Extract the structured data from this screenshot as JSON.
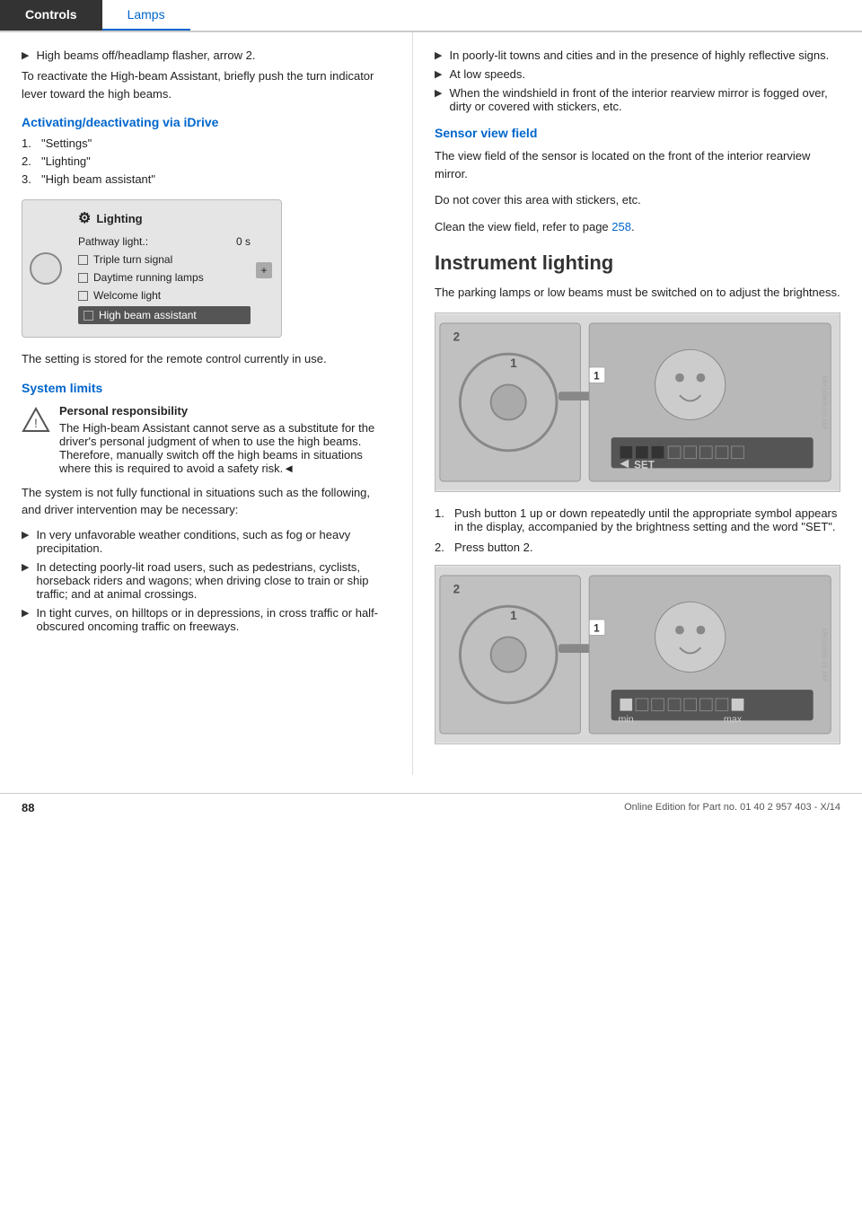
{
  "header": {
    "tab_controls": "Controls",
    "tab_lamps": "Lamps"
  },
  "left_col": {
    "bullet1": "High beams off/headlamp flasher, arrow 2.",
    "reactivate_text": "To reactivate the High-beam Assistant, briefly push the turn indicator lever toward the high beams.",
    "activating_heading": "Activating/deactivating via iDrive",
    "step1": "\"Settings\"",
    "step2": "\"Lighting\"",
    "step3": "\"High beam assistant\"",
    "idrive": {
      "title": "Lighting",
      "pathway_label": "Pathway light.:",
      "pathway_value": "0 s",
      "triple_label": "Triple turn signal",
      "daytime_label": "Daytime running lamps",
      "welcome_label": "Welcome light",
      "high_beam_label": "High beam assistant"
    },
    "setting_stored": "The setting is stored for the remote control currently in use.",
    "system_limits_heading": "System limits",
    "warning_title": "Personal responsibility",
    "warning_text": "The High-beam Assistant cannot serve as a substitute for the driver's personal judgment of when to use the high beams. Therefore, manually switch off the high beams in situations where this is required to avoid a safety risk.◄",
    "system_not_functional": "The system is not fully functional in situations such as the following, and driver intervention may be necessary:",
    "limit1": "In very unfavorable weather conditions, such as fog or heavy precipitation.",
    "limit2": "In detecting poorly-lit road users, such as pedestrians, cyclists, horseback riders and wagons; when driving close to train or ship traffic; and at animal crossings.",
    "limit3": "In tight curves, on hilltops or in depressions, in cross traffic or half-obscured oncoming traffic on freeways."
  },
  "right_col": {
    "limit4": "In poorly-lit towns and cities and in the presence of highly reflective signs.",
    "limit5": "At low speeds.",
    "limit6": "When the windshield in front of the interior rearview mirror is fogged over, dirty or covered with stickers, etc.",
    "sensor_heading": "Sensor view field",
    "sensor_text1": "The view field of the sensor is located on the front of the interior rearview mirror.",
    "sensor_text2": "Do not cover this area with stickers, etc.",
    "sensor_text3": "Clean the view field, refer to page",
    "sensor_page_link": "258",
    "sensor_period": ".",
    "instrument_heading": "Instrument lighting",
    "instrument_text": "The parking lamps or low beams must be switched on to adjust the brightness.",
    "step1": "Push button 1 up or down repeatedly until the appropriate symbol appears in the display, accompanied by the brightness setting and the word \"SET\".",
    "step2": "Press button 2.",
    "img1_alt": "Instrument lighting diagram 1",
    "img2_alt": "Instrument lighting diagram 2"
  },
  "footer": {
    "page_number": "88",
    "info_text": "Online Edition for Part no. 01 40 2 957 403 - X/14"
  }
}
